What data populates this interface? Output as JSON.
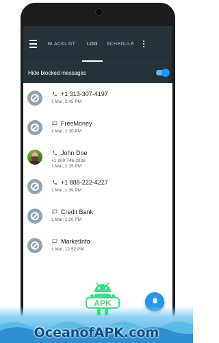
{
  "toolbar": {
    "menu_icon": "hamburger-menu-icon",
    "tabs": [
      {
        "label": "BLACKLIST"
      },
      {
        "label": "LOG"
      },
      {
        "label": "SCHEDULE"
      }
    ],
    "active_tab": "LOG",
    "overflow_icon": "more-vert-icon",
    "background_color": "#263238"
  },
  "settings": {
    "hide_blocked_label": "Hide blocked messages",
    "hide_blocked_on": true,
    "toggle_color": "#2196f3"
  },
  "log": [
    {
      "title": "+1 313-307-4197",
      "kind": "call",
      "subtitle": "1 Mar, 2:45 PM",
      "avatar": "blocked-icon"
    },
    {
      "title": "FreeMoney",
      "kind": "message",
      "subtitle": "1 Mar, 2:30 PM",
      "avatar": "blocked-icon"
    },
    {
      "title": "John Doe",
      "kind": "call",
      "number": "+1 800-746-2936",
      "subtitle": "1 Mar, 2:15 PM",
      "avatar": "contact-photo"
    },
    {
      "title": "+1 888-222-4227",
      "kind": "call",
      "subtitle": "1 Mar, 1:39 PM",
      "avatar": "blocked-icon"
    },
    {
      "title": "Credit Bank",
      "kind": "message",
      "subtitle": "1 Mar, 1:20 PM",
      "avatar": "blocked-icon"
    },
    {
      "title": "MarketInfo",
      "kind": "message",
      "subtitle": "1 Mar, 12:52 PM",
      "avatar": "blocked-icon"
    }
  ],
  "fab": {
    "icon": "trash-icon",
    "color": "#2196f3"
  },
  "watermark": {
    "text": "OceanofAPK.com",
    "logo_text": "APK"
  }
}
